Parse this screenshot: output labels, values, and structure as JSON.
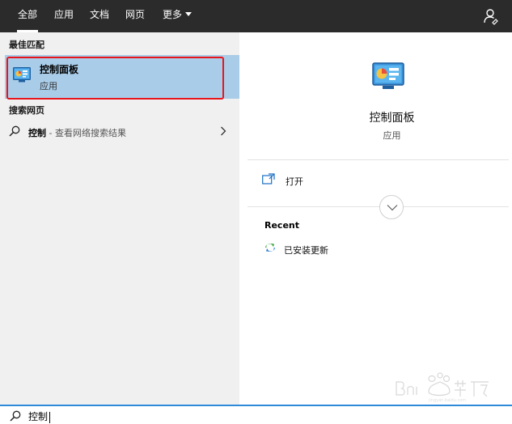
{
  "tabs": [
    {
      "label": "全部",
      "active": true
    },
    {
      "label": "应用",
      "active": false
    },
    {
      "label": "文档",
      "active": false
    },
    {
      "label": "网页",
      "active": false
    },
    {
      "label": "更多",
      "active": false,
      "dropdown": true
    }
  ],
  "feedback_icon": "feedback-person-icon",
  "left": {
    "best_match_heading": "最佳匹配",
    "best_match": {
      "title": "控制面板",
      "subtitle": "应用",
      "icon": "control-panel-icon"
    },
    "web_heading": "搜索网页",
    "web_result": {
      "bold": "控制",
      "hint": " - 查看网络搜索结果",
      "icon": "search-icon",
      "chevron": "chevron-right-icon"
    }
  },
  "right": {
    "app_title": "控制面板",
    "app_subtitle": "应用",
    "actions": [
      {
        "label": "打开",
        "icon": "open-window-icon"
      }
    ],
    "recent_heading": "Recent",
    "recent_items": [
      {
        "label": "已安装更新",
        "icon": "installed-updates-icon"
      }
    ]
  },
  "search": {
    "query": "控制",
    "icon": "search-icon"
  },
  "colors": {
    "topbar": "#2b2b2b",
    "left_panel": "#f0f0f0",
    "selected": "#a9cce8",
    "highlight_outline": "#e8141c",
    "search_border": "#2e8ad8"
  }
}
